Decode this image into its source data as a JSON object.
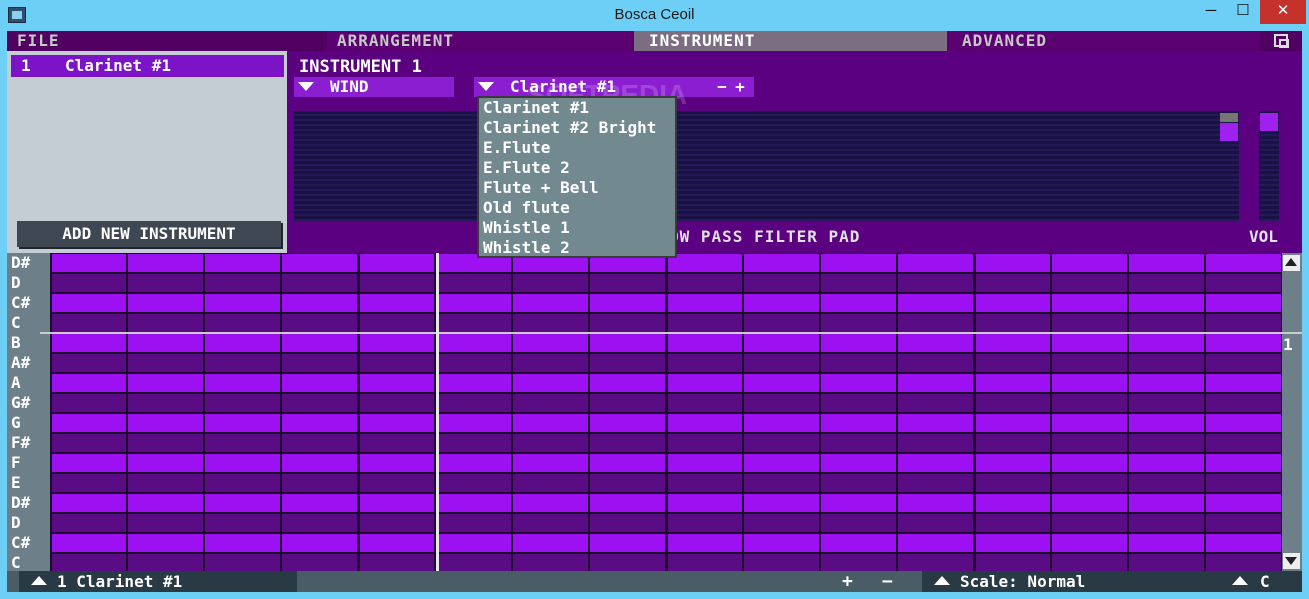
{
  "window": {
    "title": "Bosca Ceoil",
    "min": "─",
    "max": "☐",
    "close": "✕"
  },
  "menu": {
    "file": "FILE",
    "arrangement": "ARRANGEMENT",
    "instrument": "INSTRUMENT",
    "advanced": "ADVANCED"
  },
  "instrument_list": {
    "items": [
      {
        "number": "1",
        "name": "Clarinet #1"
      }
    ],
    "add_button": "ADD NEW INSTRUMENT"
  },
  "editor": {
    "title": "INSTRUMENT 1",
    "category": "WIND",
    "preset": "Clarinet #1",
    "minus": "−",
    "plus": "+",
    "filter_label": "OW PASS FILTER PAD",
    "vol_label": "VOL",
    "watermark": "SOFTPEDIA"
  },
  "preset_dropdown": [
    "Clarinet #1",
    "Clarinet #2 Bright",
    "E.Flute",
    "E.Flute 2",
    "Flute + Bell",
    "Old flute",
    "Whistle 1",
    "Whistle 2"
  ],
  "piano_roll": {
    "notes": [
      "D#",
      "D",
      "C#",
      "C",
      "B",
      "A#",
      "A",
      "G#",
      "G",
      "F#",
      "F",
      "E",
      "D#",
      "D",
      "C#",
      "C"
    ],
    "octave": "1",
    "colors": {
      "light": "#9d10f2",
      "dark": "#5a0c85"
    }
  },
  "bottom_bar": {
    "instrument": "1  Clarinet #1",
    "plus": "+",
    "minus": "−",
    "scale": "Scale: Normal",
    "key": "C"
  }
}
